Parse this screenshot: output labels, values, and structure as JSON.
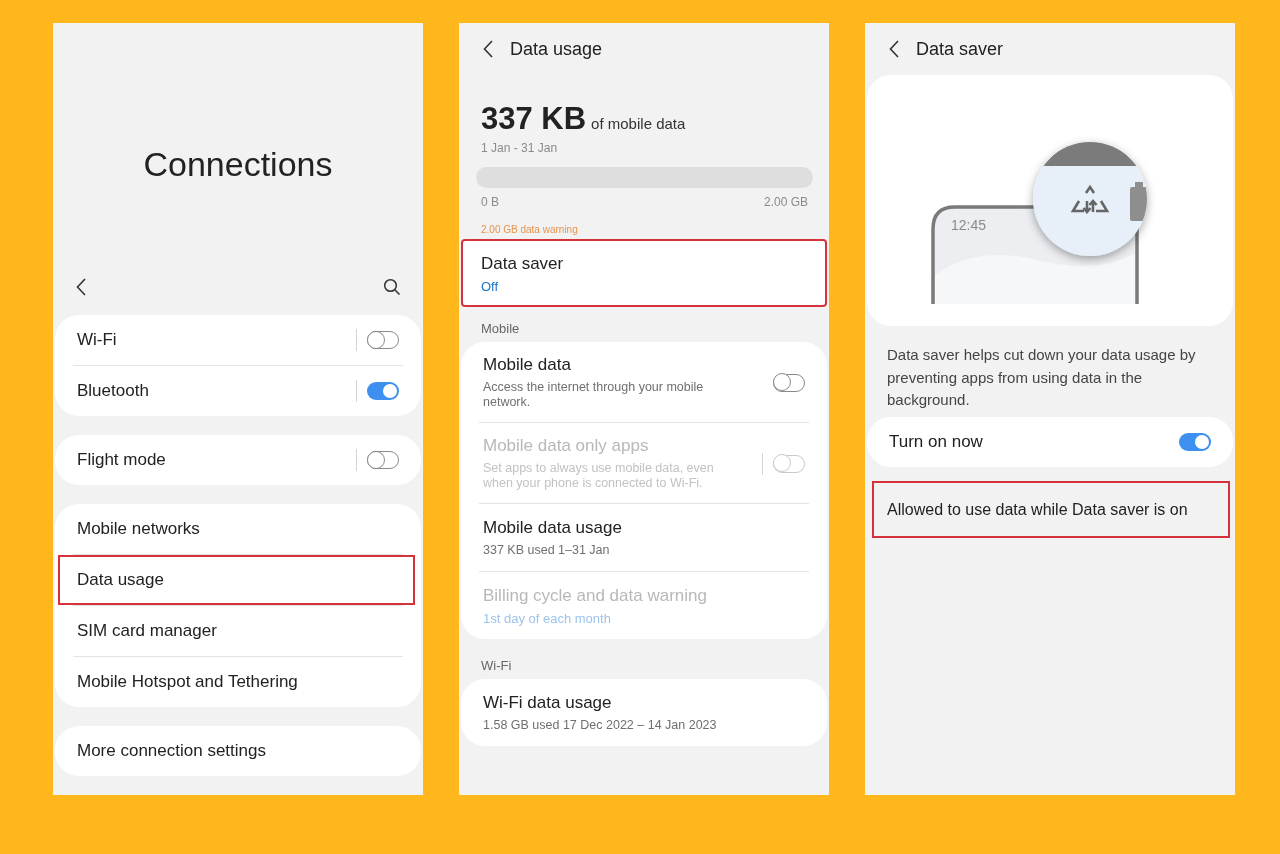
{
  "connections": {
    "title": "Connections",
    "groups": [
      {
        "items": [
          {
            "kind": "toggle",
            "label": "Wi-Fi",
            "on": false,
            "highlighted": false
          },
          {
            "kind": "toggle",
            "label": "Bluetooth",
            "on": true,
            "highlighted": false
          }
        ]
      },
      {
        "items": [
          {
            "kind": "toggle",
            "label": "Flight mode",
            "on": false,
            "highlighted": false
          }
        ]
      },
      {
        "items": [
          {
            "kind": "link",
            "label": "Mobile networks",
            "highlighted": false
          },
          {
            "kind": "link",
            "label": "Data usage",
            "highlighted": true
          },
          {
            "kind": "link",
            "label": "SIM card manager",
            "highlighted": false
          },
          {
            "kind": "link",
            "label": "Mobile Hotspot and Tethering",
            "highlighted": false
          }
        ]
      },
      {
        "items": [
          {
            "kind": "link",
            "label": "More connection settings",
            "highlighted": false
          }
        ]
      }
    ]
  },
  "data_usage": {
    "title": "Data usage",
    "amount": "337 KB",
    "amount_unit": "of mobile data",
    "period": "1 Jan - 31 Jan",
    "usage_bar": {
      "level": 0
    },
    "bar_min": "0 B",
    "bar_max": "2.00 GB",
    "warning": "2.00 GB data warning",
    "data_saver": {
      "title": "Data saver",
      "status": "Off",
      "highlighted": true
    },
    "sections": [
      {
        "heading": "Mobile",
        "items": [
          {
            "kind": "toggle",
            "title": "Mobile data",
            "subtitle": "Access the internet through your mobile network.",
            "on": false,
            "disabled": false,
            "subtitle_accent": false
          },
          {
            "kind": "toggle",
            "title": "Mobile data only apps",
            "subtitle": "Set apps to always use mobile data, even when your phone is connected to Wi-Fi.",
            "on": false,
            "disabled": true,
            "subtitle_accent": false
          },
          {
            "kind": "link",
            "title": "Mobile data usage",
            "subtitle": "337 KB used 1–31 Jan",
            "disabled": false,
            "subtitle_accent": false
          },
          {
            "kind": "link",
            "title": "Billing cycle and data warning",
            "subtitle": "1st day of each month",
            "disabled": true,
            "subtitle_accent": true
          }
        ]
      },
      {
        "heading": "Wi-Fi",
        "items": [
          {
            "kind": "link",
            "title": "Wi-Fi data usage",
            "subtitle": "1.58 GB used 17 Dec 2022 – 14 Jan 2023",
            "disabled": false,
            "subtitle_accent": false
          }
        ]
      }
    ]
  },
  "data_saver": {
    "title": "Data saver",
    "illustration_time": "12:45",
    "description": "Data saver helps cut down your data usage by preventing apps from using data in the background.",
    "items": [
      {
        "kind": "toggle",
        "label": "Turn on now",
        "on": true,
        "highlighted": false
      },
      {
        "kind": "link",
        "label": "Allowed to use data while Data saver is on",
        "highlighted": true
      }
    ]
  }
}
